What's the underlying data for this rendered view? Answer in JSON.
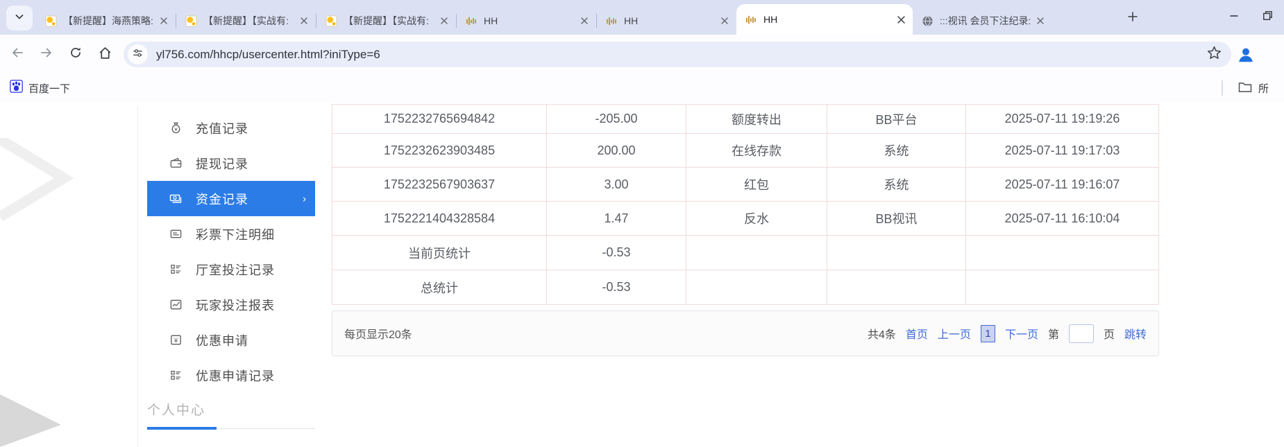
{
  "browser": {
    "tabs": [
      {
        "title": "【新提醒】海燕策略:",
        "favicon": "forum-yellow",
        "active": false
      },
      {
        "title": "【新提醒】【实战有:",
        "favicon": "forum-yellow",
        "active": false
      },
      {
        "title": "【新提醒】【实战有:",
        "favicon": "forum-yellow",
        "active": false
      },
      {
        "title": "HH",
        "favicon": "gold-wave",
        "active": false
      },
      {
        "title": "HH",
        "favicon": "gold-wave",
        "active": false
      },
      {
        "title": "HH",
        "favicon": "gold-wave",
        "active": true
      },
      {
        "title": ":::视讯 会员下注纪录:",
        "favicon": "globe",
        "active": false
      }
    ],
    "url": "yl756.com/hhcp/usercenter.html?iniType=6",
    "bookmark_label": "百度一下",
    "overflow_bookmark_label": "所"
  },
  "sidebar": {
    "items": [
      {
        "label": "充值记录",
        "icon": "moneybag-icon",
        "active": false
      },
      {
        "label": "提现记录",
        "icon": "wallet-icon",
        "active": false
      },
      {
        "label": "资金记录",
        "icon": "banknotes-icon",
        "active": true
      },
      {
        "label": "彩票下注明细",
        "icon": "receipt-icon",
        "active": false
      },
      {
        "label": "厅室投注记录",
        "icon": "list-icon",
        "active": false
      },
      {
        "label": "玩家投注报表",
        "icon": "chart-icon",
        "active": false
      },
      {
        "label": "优惠申请",
        "icon": "coupon-icon",
        "active": false
      },
      {
        "label": "优惠申请记录",
        "icon": "list-icon",
        "active": false
      }
    ],
    "active_chevron": "›",
    "section_title": "个人中心"
  },
  "table": {
    "rows": [
      [
        "1752232765694842",
        "-205.00",
        "额度转出",
        "BB平台",
        "2025-07-11 19:19:26"
      ],
      [
        "1752232623903485",
        "200.00",
        "在线存款",
        "系统",
        "2025-07-11 19:17:03"
      ],
      [
        "1752232567903637",
        "3.00",
        "红包",
        "系统",
        "2025-07-11 19:16:07"
      ],
      [
        "1752221404328584",
        "1.47",
        "反水",
        "BB视讯",
        "2025-07-11 16:10:04"
      ],
      [
        "当前页统计",
        "-0.53",
        "",
        "",
        ""
      ],
      [
        "总统计",
        "-0.53",
        "",
        "",
        ""
      ]
    ]
  },
  "pagination": {
    "per_page": "每页显示20条",
    "total": "共4条",
    "first": "首页",
    "prev": "上一页",
    "current": "1",
    "next": "下一页",
    "jump_pre": "第",
    "jump_post": "页",
    "jump_btn": "跳转"
  },
  "colors": {
    "accent_blue": "#2b7ce7",
    "link_blue": "#3f6bd8",
    "table_border_pink": "#f2dada",
    "tabstrip_bg": "#dbe1f3"
  }
}
